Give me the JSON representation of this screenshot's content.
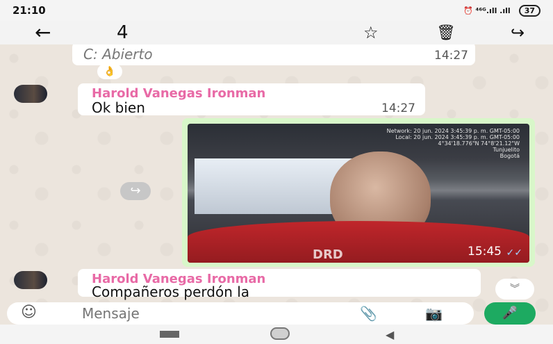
{
  "status_bar": {
    "time": "21:10",
    "right": "⏰  ⁴⁶ᴳ.ıll .ıll",
    "battery": "37"
  },
  "app_bar": {
    "selected_count": "4"
  },
  "messages": [
    {
      "text": "Abierto",
      "time": "14:27",
      "reaction": "👌"
    },
    {
      "sender": "Harold Vanegas Ironman",
      "text": "Ok bien",
      "time": "14:27"
    },
    {
      "type": "image",
      "overlay": [
        "Network: 20 jun. 2024 3:45:39 p. m. GMT-05:00",
        "Local: 20 jun. 2024 3:45:39 p. m. GMT-05:00",
        "4°34'18.776\"N 74°8'21.12\"W",
        "Tunjuelito",
        "Bogotá"
      ],
      "shirt_text": "DRD",
      "time": "15:45"
    },
    {
      "sender": "Harold Vanegas Ironman",
      "text": "Compañeros perdón la"
    }
  ],
  "composer": {
    "placeholder": "Mensaje"
  },
  "colors": {
    "sender": "#e86aa6",
    "outgoing_bubble": "#d8f7c9",
    "mic_button": "#1daa61"
  }
}
